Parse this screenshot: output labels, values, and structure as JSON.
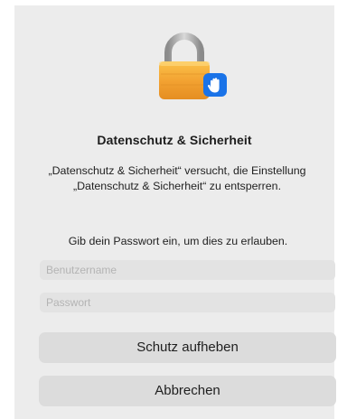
{
  "dialog": {
    "title": "Datenschutz & Sicherheit",
    "message": "„Datenschutz & Sicherheit“ versucht, die Einstellung „Datenschutz & Sicherheit“ zu entsperren.",
    "prompt": "Gib dein Passwort ein, um dies zu erlauben.",
    "username": {
      "placeholder": "Benutzername",
      "value": ""
    },
    "password": {
      "placeholder": "Passwort",
      "value": ""
    },
    "unlock_label": "Schutz aufheben",
    "cancel_label": "Abbrechen",
    "icons": {
      "lock": "padlock-icon",
      "badge": "raised-hand-icon"
    },
    "colors": {
      "lock_body": "#f4a534",
      "shackle": "#9a9a9a",
      "badge": "#1a73e8",
      "dialog_bg": "#ececec",
      "button_bg": "#dcdcdc"
    }
  }
}
